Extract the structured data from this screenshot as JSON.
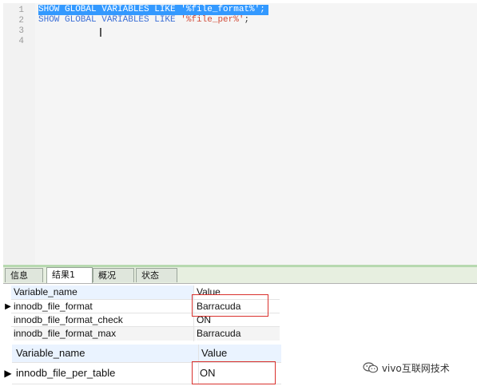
{
  "editor": {
    "line_numbers": [
      "1",
      "2",
      "3",
      "4"
    ],
    "lines": [
      {
        "keywords": "SHOW GLOBAL VARIABLES LIKE ",
        "string": "'%file_format%'",
        "end": ";"
      },
      {
        "keywords": "SHOW GLOBAL VARIABLES LIKE ",
        "string": "'%file_per%'",
        "end": ";"
      }
    ]
  },
  "tabs": [
    {
      "label": "信息"
    },
    {
      "label": "结果1"
    },
    {
      "label": "概况"
    },
    {
      "label": "状态"
    }
  ],
  "result1": {
    "columns": [
      "Variable_name",
      "Value"
    ],
    "rows": [
      {
        "name": "innodb_file_format",
        "value": "Barracuda"
      },
      {
        "name": "innodb_file_format_check",
        "value": "ON"
      },
      {
        "name": "innodb_file_format_max",
        "value": "Barracuda"
      }
    ]
  },
  "result2": {
    "columns": [
      "Variable_name",
      "Value"
    ],
    "rows": [
      {
        "name": "innodb_file_per_table",
        "value": "ON"
      }
    ]
  },
  "colors": {
    "selection": "#3399ff",
    "keyword": "#3b6fd6",
    "string": "#d24d3a",
    "highlight_box": "#d9302c",
    "header_bg": "#eaf3ff"
  },
  "watermark": {
    "text": "vivo互联网技术",
    "icon": "wechat-icon"
  }
}
